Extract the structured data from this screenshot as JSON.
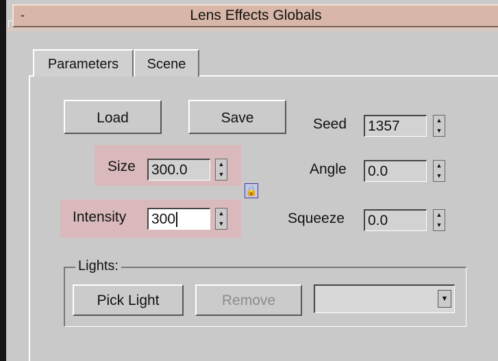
{
  "rollout": {
    "toggle_label": "-",
    "title": "Lens Effects Globals"
  },
  "tabs": [
    {
      "label": "Parameters"
    },
    {
      "label": "Scene"
    }
  ],
  "buttons": {
    "load_label": "Load",
    "save_label": "Save",
    "pick_light_label": "Pick Light",
    "remove_label": "Remove"
  },
  "fields": {
    "size": {
      "label": "Size",
      "value": "300.0"
    },
    "intensity": {
      "label": "Intensity",
      "value": "300"
    },
    "seed": {
      "label": "Seed",
      "value": "1357"
    },
    "angle": {
      "label": "Angle",
      "value": "0.0"
    },
    "squeeze": {
      "label": "Squeeze",
      "value": "0.0"
    }
  },
  "lights": {
    "group_label": "Lights:",
    "dropdown_value": ""
  },
  "icons": {
    "spinner": "up-down-arrows-icon",
    "lock": "lock-icon",
    "dropdown": "dropdown-arrow-icon"
  },
  "colors": {
    "rollout_bar": "#d8b6a8",
    "highlight": "#d9b9bc",
    "panel_bg": "#c9c9c9"
  }
}
